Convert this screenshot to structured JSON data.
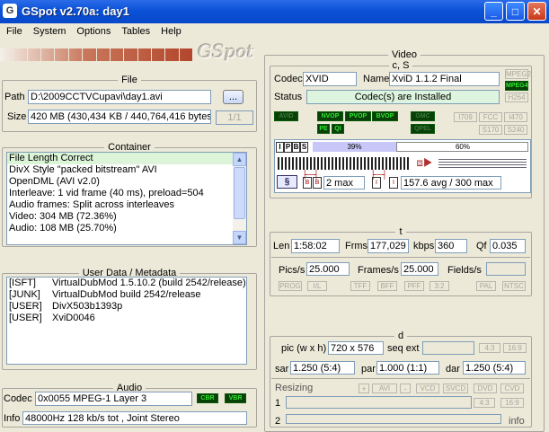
{
  "window": {
    "title": "GSpot v2.70a: day1"
  },
  "menu": [
    "File",
    "System",
    "Options",
    "Tables",
    "Help"
  ],
  "logo": {
    "text": "GSpot"
  },
  "file": {
    "title": "File",
    "path_label": "Path",
    "path": "D:\\2009CCTVCupavi\\day1.avi",
    "browse_label": "...",
    "size_label": "Size",
    "size": "420 MB (430,434 KB / 440,764,416 bytes)",
    "page": "1/1"
  },
  "container": {
    "title": "Container",
    "lines": [
      "File Length Correct",
      "DivX Style \"packed bitstream\" AVI",
      "OpenDML (AVI v2.0)",
      "Interleave: 1 vid frame (40 ms), preload=504",
      "Audio frames: Split across interleaves",
      "Video: 304 MB (72.36%)",
      "Audio: 108 MB (25.70%)"
    ]
  },
  "userdata": {
    "title": "User Data / Metadata",
    "rows": [
      [
        "[ISFT]",
        "VirtualDubMod 1.5.10.2 (build 2542/release)"
      ],
      [
        "[JUNK]",
        "VirtualDubMod build 2542/release"
      ],
      [
        "[USER]",
        "DivX503b1393p"
      ],
      [
        "[USER]",
        "XviD0046"
      ]
    ]
  },
  "audio": {
    "title": "Audio",
    "codec_label": "Codec",
    "codec": "0x0055 MPEG-1 Layer 3",
    "cbr": "CBR",
    "vbr": "VBR",
    "info_label": "Info",
    "info": "48000Hz  128 kb/s tot , Joint Stereo"
  },
  "video": {
    "title": "Video",
    "cs": {
      "title": "c, S",
      "codec_label": "Codec",
      "codec": "XVID",
      "name_label": "Name",
      "name": "XviD 1.1.2 Final",
      "status_label": "Status",
      "status": "Codec(s) are Installed",
      "mpeg2": "MPEG2",
      "mpeg4": "MPEG4",
      "h264": "H264"
    },
    "flags": {
      "avid": "AVID",
      "nvop": "NVOP",
      "pvop": "PVOP",
      "bvop": "BVOP",
      "pe": "PE",
      "qi": "QI",
      "gmc": "GMC",
      "qpel": "QPEL",
      "i709": "I709",
      "fcc": "FCC",
      "i470": "I470",
      "s170": "S170",
      "s240": "S240"
    },
    "timeline": {
      "packets": [
        "I",
        "P",
        "B",
        "S"
      ],
      "pct_left": "39%",
      "pct_right": "60%",
      "left_fraction": 0.39,
      "bframes": "2 max",
      "bitrate": "157.6 avg / 300 max"
    },
    "t": {
      "title": "t",
      "len_label": "Len",
      "len": "1:58:02",
      "frms_label": "Frms",
      "frms": "177,029",
      "kbps_label": "kbps",
      "kbps": "360",
      "qf_label": "Qf",
      "qf": "0.035",
      "pics_label": "Pics/s",
      "pics": "25.000",
      "frames_label": "Frames/s",
      "frames": "25.000",
      "fields_label": "Fields/s",
      "prog": "PROG",
      "il": "I/L",
      "tff": "TFF",
      "bff": "BFF",
      "pff": "PFF",
      "r32": "3:2",
      "pal": "PAL",
      "ntsc": "NTSC"
    },
    "d": {
      "title": "d",
      "pic_label": "pic (w x h)",
      "pic": "720 x 576",
      "seq_label": "seq ext",
      "r43": "4:3",
      "r169": "16:9",
      "sar_label": "sar",
      "sar": "1.250 (5:4)",
      "par_label": "par",
      "par": "1.000 (1:1)",
      "dar_label": "dar",
      "dar": "1.250 (5:4)",
      "resizing_label": "Resizing",
      "plus": "+",
      "avi": "AVI",
      "minus": "-",
      "vcd": "VCD",
      "svcd": "SVCD",
      "dvd": "DVD",
      "cvd": "CVD",
      "row1": "1",
      "row2": "2",
      "r43b": "4:3",
      "r169b": "16:9",
      "info": "info"
    }
  }
}
